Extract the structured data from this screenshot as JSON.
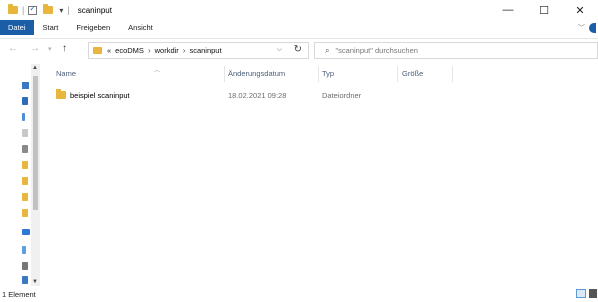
{
  "window": {
    "title": "scaninput",
    "minimize": "—",
    "maximize": "☐",
    "close": "✕"
  },
  "ribbon": {
    "tabs": [
      "Datei",
      "Start",
      "Freigeben",
      "Ansicht"
    ]
  },
  "address": {
    "overflow": "«",
    "crumbs": [
      "ecoDMS",
      "workdir",
      "scaninput"
    ],
    "separator": "›"
  },
  "search": {
    "placeholder": "\"scaninput\" durchsuchen"
  },
  "columns": [
    "Name",
    "Änderungsdatum",
    "Typ",
    "Größe"
  ],
  "files": [
    {
      "name": "beispiel scaninput",
      "date": "18.02.2021 09:28",
      "type": "Dateiordner",
      "size": ""
    }
  ],
  "status": {
    "count": "1 Element"
  },
  "colors": {
    "accent": "#1a5ea8",
    "folder": "#e8b63c"
  }
}
